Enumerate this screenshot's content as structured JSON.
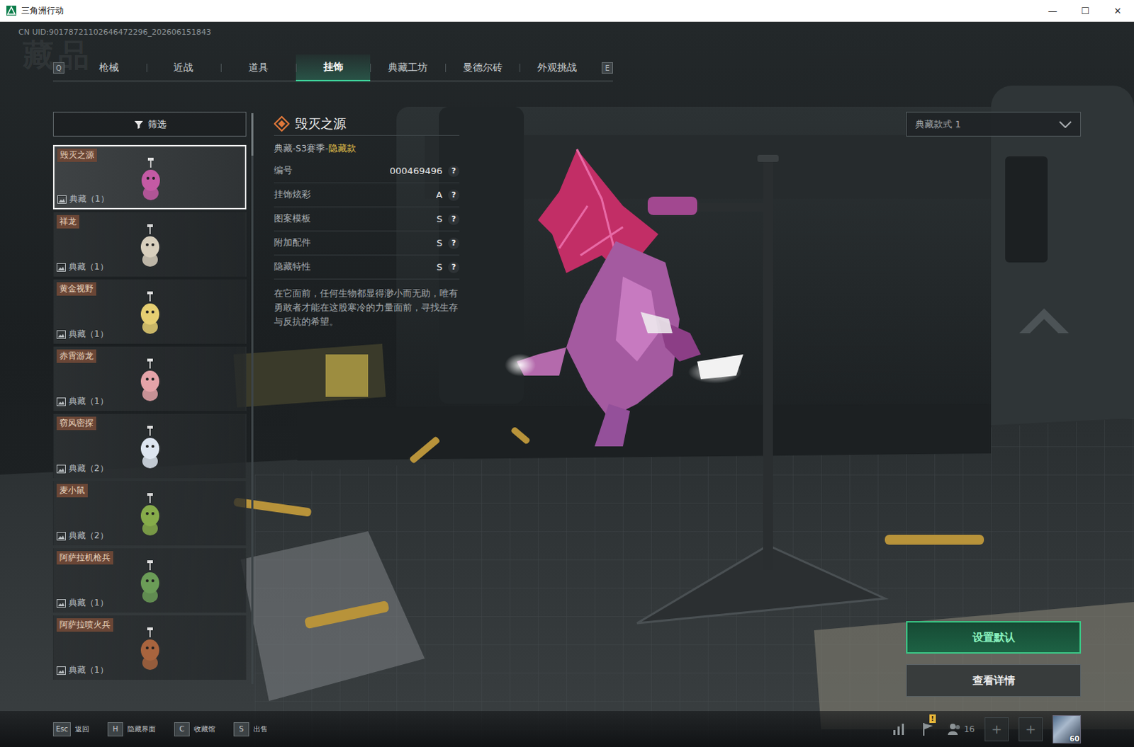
{
  "window": {
    "title": "三角洲行动",
    "controls": [
      "—",
      "☐",
      "✕"
    ]
  },
  "uid": "CN UID:90178721102646472296_202606151843",
  "page_title": "藏品",
  "tabs": {
    "prev_key": "Q",
    "next_key": "E",
    "items": [
      {
        "label": "枪械",
        "selected": false
      },
      {
        "label": "近战",
        "selected": false
      },
      {
        "label": "道具",
        "selected": false
      },
      {
        "label": "挂饰",
        "selected": true
      },
      {
        "label": "典藏工坊",
        "selected": false
      },
      {
        "label": "曼德尔砖",
        "selected": false
      },
      {
        "label": "外观挑战",
        "selected": false
      }
    ]
  },
  "filter": {
    "label": "筛选"
  },
  "items": [
    {
      "name": "毁灭之源",
      "tag": "典藏（1）",
      "selected": true
    },
    {
      "name": "祥龙",
      "tag": "典藏（1）",
      "selected": false
    },
    {
      "name": "黄金视野",
      "tag": "典藏（1）",
      "selected": false
    },
    {
      "name": "赤霄游龙",
      "tag": "典藏（1）",
      "selected": false
    },
    {
      "name": "窃风密探",
      "tag": "典藏（2）",
      "selected": false
    },
    {
      "name": "麦小鼠",
      "tag": "典藏（2）",
      "selected": false
    },
    {
      "name": "阿萨拉机枪兵",
      "tag": "典藏（1）",
      "selected": false
    },
    {
      "name": "阿萨拉喷火兵",
      "tag": "典藏（1）",
      "selected": false
    }
  ],
  "detail": {
    "title": "毁灭之源",
    "category": "典藏-S3赛季-",
    "rarity": "隐藏款",
    "attributes": [
      {
        "label": "编号",
        "value": "000469496",
        "help": "?"
      },
      {
        "label": "挂饰炫彩",
        "value": "A",
        "help": "?"
      },
      {
        "label": "图案模板",
        "value": "S",
        "help": "?"
      },
      {
        "label": "附加配件",
        "value": "S",
        "help": "?"
      },
      {
        "label": "隐藏特性",
        "value": "S",
        "help": "?"
      }
    ],
    "description": "在它面前，任何生物都显得渺小而无助，唯有勇敢者才能在这股寒冷的力量面前，寻找生存与反抗的希望。"
  },
  "style_select": {
    "value": "典藏款式 1"
  },
  "buttons": [
    {
      "label": "设置默认",
      "primary": true
    },
    {
      "label": "查看详情",
      "primary": false
    }
  ],
  "hotkeys": [
    {
      "key": "Esc",
      "label": "返回"
    },
    {
      "key": "H",
      "label": "隐藏界面"
    },
    {
      "key": "C",
      "label": "收藏馆"
    },
    {
      "key": "S",
      "label": "出售"
    }
  ],
  "status": {
    "badge": "!",
    "players": "16",
    "plus": [
      "+",
      "+"
    ],
    "level": "60"
  }
}
